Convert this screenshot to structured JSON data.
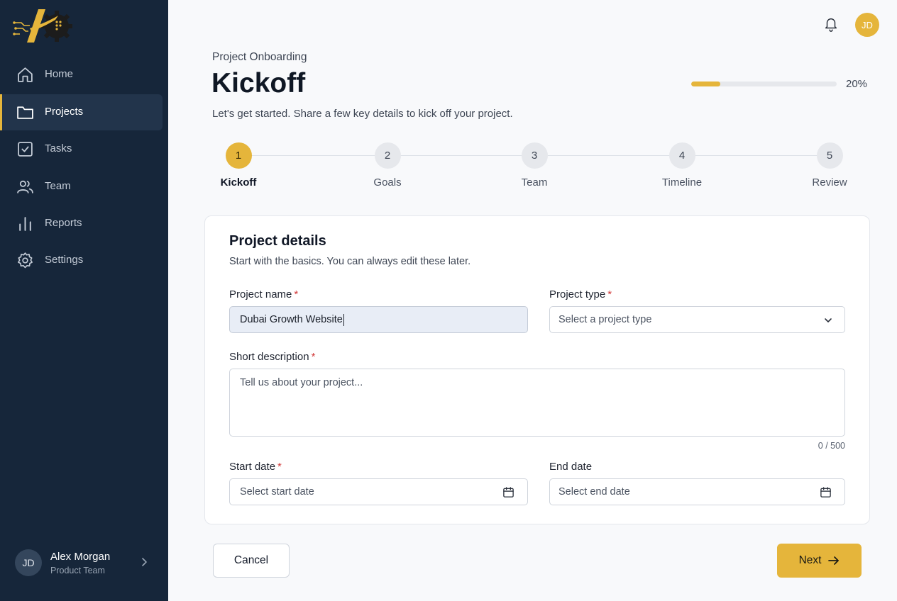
{
  "sidebar": {
    "items": [
      {
        "label": "Home",
        "icon": "home-icon"
      },
      {
        "label": "Projects",
        "icon": "folder-icon",
        "active": true
      },
      {
        "label": "Tasks",
        "icon": "checkbox-icon"
      },
      {
        "label": "Team",
        "icon": "users-icon"
      },
      {
        "label": "Reports",
        "icon": "bar-chart-icon"
      },
      {
        "label": "Settings",
        "icon": "gear-icon"
      }
    ],
    "user": {
      "initials": "JD",
      "name": "Alex Morgan",
      "role": "Product Team"
    }
  },
  "header": {
    "avatar_initials": "JD",
    "eyebrow": "Project Onboarding",
    "title": "Kickoff",
    "subtitle": "Let's get started. Share a few key details to kick off your project.",
    "progress": {
      "value": 20,
      "label": "20%"
    }
  },
  "steps": [
    {
      "number": "1",
      "label": "Kickoff",
      "active": true
    },
    {
      "number": "2",
      "label": "Goals"
    },
    {
      "number": "3",
      "label": "Team"
    },
    {
      "number": "4",
      "label": "Timeline"
    },
    {
      "number": "5",
      "label": "Review"
    }
  ],
  "form": {
    "title": "Project details",
    "subtitle": "Start with the basics. You can always edit these later.",
    "project_name": {
      "label": "Project name",
      "value": "Dubai Growth Website"
    },
    "project_type": {
      "label": "Project type",
      "placeholder": "Select a project type"
    },
    "description": {
      "label": "Short description",
      "placeholder": "Tell us about your project...",
      "counter": "0 / 500"
    },
    "start_date": {
      "label": "Start date",
      "placeholder": "Select start date"
    },
    "end_date": {
      "label": "End date",
      "placeholder": "Select end date"
    },
    "required_mark": "*"
  },
  "actions": {
    "cancel_label": "Cancel",
    "next_label": "Next"
  },
  "colors": {
    "accent": "#e5b53b",
    "sidebar": "#16263a",
    "required": "#d23b3b"
  }
}
